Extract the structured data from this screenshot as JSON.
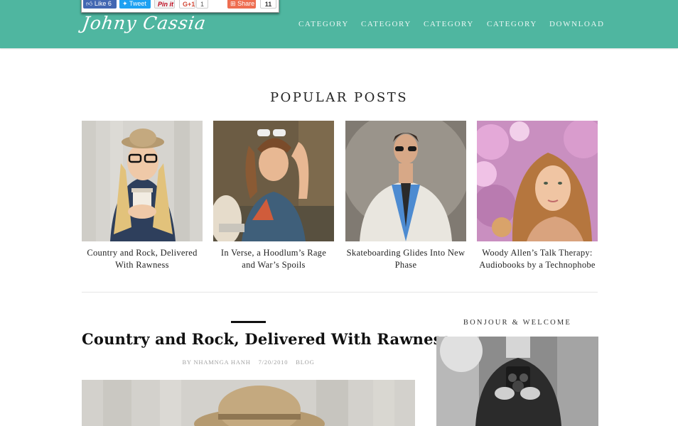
{
  "brand": {
    "logo_text": "Johny Cassia",
    "accent_color": "#4fb6a0"
  },
  "nav": {
    "items": [
      {
        "label": "CATEGORY"
      },
      {
        "label": "CATEGORY"
      },
      {
        "label": "CATEGORY"
      },
      {
        "label": "CATEGORY"
      },
      {
        "label": "DOWNLOAD"
      }
    ]
  },
  "share_bar": {
    "like_label": "Like 6",
    "tweet_label": "Tweet",
    "pin_label": "Pin it",
    "gplus_label": "G+1",
    "gplus_count": "1",
    "share_label": "Share",
    "share_count": "11"
  },
  "popular": {
    "heading": "POPULAR POSTS",
    "posts": [
      {
        "title": "Country and Rock, Delivered With Rawness",
        "image": "woman-with-hat-and-coffee-photo"
      },
      {
        "title": "In Verse, a Hoodlum’s Rage and War’s Spoils",
        "image": "woman-with-skateboard-photo"
      },
      {
        "title": "Skateboarding Glides Into New Phase",
        "image": "man-opening-shirt-photo"
      },
      {
        "title": "Woody Allen’s Talk Therapy: Audiobooks by a Technophobe",
        "image": "woman-with-blossoms-photo"
      }
    ]
  },
  "post": {
    "title": "Country and Rock, Delivered With Rawness",
    "author": "BY NHAMNGA HANH",
    "date": "7/20/2010",
    "category": "BLOG"
  },
  "sidebar": {
    "welcome_title": "BONJOUR & WELCOME",
    "welcome_image": "photographer-with-camera-photo"
  }
}
